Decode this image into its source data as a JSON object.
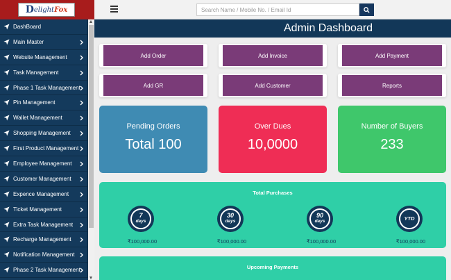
{
  "brand": {
    "logo_initial": "D",
    "logo_word_1": "elight",
    "logo_word_2": "Fox"
  },
  "search": {
    "placeholder": "Search Name / Mobile No. / Email Id"
  },
  "sidebar": {
    "items": [
      {
        "label": "DashBoard",
        "has_chevron": false
      },
      {
        "label": "Main Master",
        "has_chevron": true
      },
      {
        "label": "Website Management",
        "has_chevron": true
      },
      {
        "label": "Task Management",
        "has_chevron": true
      },
      {
        "label": "Phase 1 Task Management",
        "has_chevron": true
      },
      {
        "label": "Pin Management",
        "has_chevron": true
      },
      {
        "label": "Wallet Management",
        "has_chevron": true
      },
      {
        "label": "Shopping Management",
        "has_chevron": true
      },
      {
        "label": "First Product Management",
        "has_chevron": true
      },
      {
        "label": "Employee Management",
        "has_chevron": true
      },
      {
        "label": "Customer Management",
        "has_chevron": true
      },
      {
        "label": "Expence Management",
        "has_chevron": true
      },
      {
        "label": "Ticket Management",
        "has_chevron": true
      },
      {
        "label": "Extra Task Management",
        "has_chevron": true
      },
      {
        "label": "Recharge Management",
        "has_chevron": true
      },
      {
        "label": "Notification Management",
        "has_chevron": true
      },
      {
        "label": "Phase 2 Task Management",
        "has_chevron": true
      }
    ]
  },
  "header": {
    "title": "Admin Dashboard"
  },
  "actions": {
    "add_order": "Add Order",
    "add_invoice": "Add Invoice",
    "add_payment": "Add Payment",
    "add_gr": "Add GR",
    "add_customer": "Add Customer",
    "reports": "Reports"
  },
  "stats": {
    "pending_orders": {
      "label": "Pending Orders",
      "value": "Total 100",
      "color": "#3f8bb3"
    },
    "over_dues": {
      "label": "Over Dues",
      "value": "10,0000",
      "color": "#ef2d55"
    },
    "buyers": {
      "label": "Number of Buyers",
      "value": "233",
      "color": "#3fc76b"
    }
  },
  "purchases": {
    "title": "Total Purchases",
    "periods": [
      {
        "num": "7",
        "unit": "days",
        "amount": "₹100,000.00"
      },
      {
        "num": "30",
        "unit": "days",
        "amount": "₹100,000.00"
      },
      {
        "num": "90",
        "unit": "days",
        "amount": "₹100,000.00"
      },
      {
        "num": "YTD",
        "unit": "",
        "amount": "₹100,000.00"
      }
    ]
  },
  "payments": {
    "title": "Upcoming Payments"
  },
  "colors": {
    "navy": "#123758",
    "purple": "#7a3b78",
    "teal": "#2fcfa7",
    "logo_red": "#a81c1c"
  }
}
